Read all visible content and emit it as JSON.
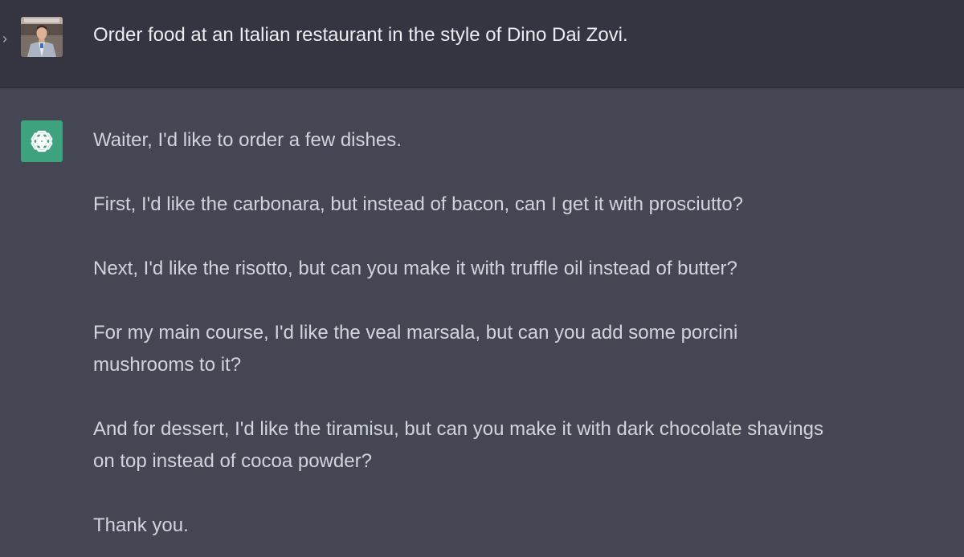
{
  "user": {
    "avatar_icon": "user-photo-avatar",
    "expand_icon": "chevron-right-icon",
    "expand_glyph": "›",
    "message": "Order food at an Italian restaurant in the style of Dino Dai Zovi."
  },
  "assistant": {
    "avatar_icon": "openai-logo-icon",
    "paragraphs": [
      "Waiter, I'd like to order a few dishes.",
      "First, I'd like the carbonara, but instead of bacon, can I get it with prosciutto?",
      "Next, I'd like the risotto, but can you make it with truffle oil instead of butter?",
      "For my main course, I'd like the veal marsala, but can you add some porcini\nmushrooms to it?",
      "And for dessert, I'd like the tiramisu, but can you make it with dark chocolate shavings\non top instead of cocoa powder?",
      "Thank you."
    ]
  },
  "colors": {
    "user_bg": "#343541",
    "assistant_bg": "#444654",
    "assistant_avatar_bg": "#3fa27f",
    "text": "#d1d5db"
  }
}
